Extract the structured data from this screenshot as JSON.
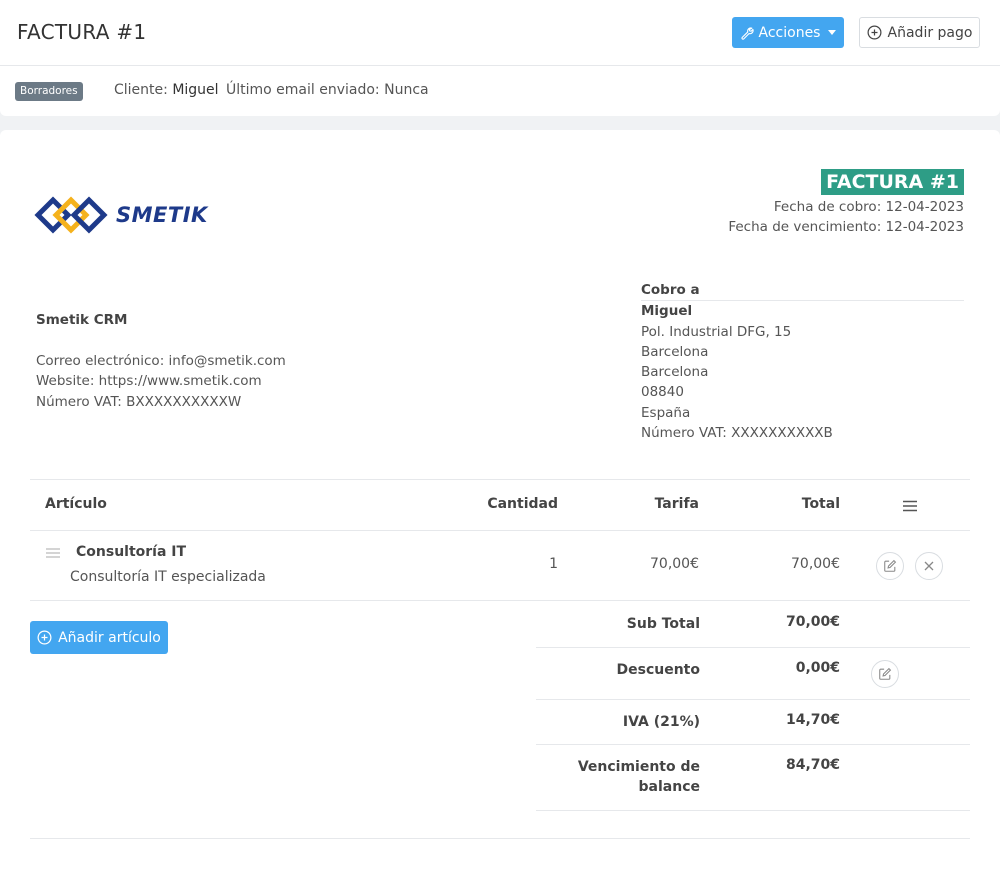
{
  "header": {
    "title": "FACTURA #1",
    "actions_label": "Acciones",
    "add_payment_label": "Añadir pago"
  },
  "status": {
    "badge": "Borradores",
    "client_label": "Cliente:",
    "client_name": "Miguel",
    "last_email_label": "Último email enviado:",
    "last_email_value": "Nunca"
  },
  "invoice": {
    "logo_text": "SMETIK",
    "title": "FACTURA #1",
    "charge_date": "Fecha de cobro: 12-04-2023",
    "due_date": "Fecha de vencimiento: 12-04-2023"
  },
  "company": {
    "name": "Smetik CRM",
    "email": "Correo electrónico: info@smetik.com",
    "website": "Website: https://www.smetik.com",
    "vat": "Número VAT: BXXXXXXXXXXW"
  },
  "bill_to": {
    "heading": "Cobro a",
    "name": "Miguel",
    "address": "Pol. Industrial DFG, 15",
    "city": "Barcelona",
    "province": "Barcelona",
    "postal": "08840",
    "country": "España",
    "vat": "Número VAT: XXXXXXXXXXB"
  },
  "table": {
    "headers": [
      "Artículo",
      "Cantidad",
      "Tarifa",
      "Total"
    ],
    "items": [
      {
        "name": "Consultoría IT",
        "description": "Consultoría IT especializada",
        "quantity": "1",
        "rate": "70,00€",
        "total": "70,00€"
      }
    ],
    "add_item_label": "Añadir artículo"
  },
  "summary": {
    "subtotal_label": "Sub Total",
    "subtotal_value": "70,00€",
    "discount_label": "Descuento",
    "discount_value": "0,00€",
    "tax_label": "IVA (21%)",
    "tax_value": "14,70€",
    "balance_label_line1": "Vencimiento de",
    "balance_label_line2": "balance",
    "balance_value": "84,70€"
  },
  "colors": {
    "primary": "#43a6f0",
    "invoice_badge": "#2e9d86",
    "status_badge": "#6c7a86",
    "logo_blue": "#1e3a8a",
    "logo_yellow": "#f5b21c"
  }
}
